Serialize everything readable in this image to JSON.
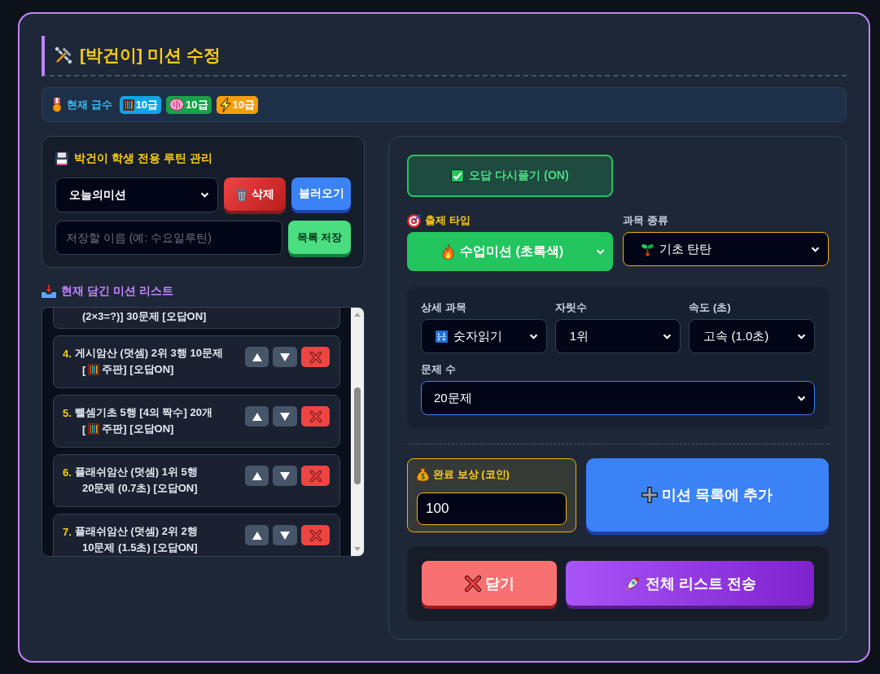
{
  "modal": {
    "title": "[박건이] 미션 수정"
  },
  "grade": {
    "label": "현재 급수",
    "badges": [
      {
        "kind": "abacus",
        "text": "10급",
        "color": "#0ea5e9"
      },
      {
        "kind": "brain",
        "text": "10급",
        "color": "#16a34a"
      },
      {
        "kind": "lightning",
        "text": "10급",
        "color": "#f59e0b"
      }
    ]
  },
  "routine_panel": {
    "title": "박건이 학생 전용 루틴 관리",
    "routine_select": {
      "value": "오늘의미션"
    },
    "delete_button": "삭제",
    "load_button": "불러오기",
    "name_field": {
      "placeholder": "저장할 이름 (예: 수요일루틴)"
    },
    "save_button": "목록 저장"
  },
  "mission_list": {
    "title": "현재 담긴 미션 리스트",
    "partial_item_text": "(2×3=?)] 30문제 [오답ON]",
    "items": [
      {
        "number": "4.",
        "line1": "게시암산 (덧셈) 2위 3행 10문제",
        "tool_open": "[",
        "line2": "주판] [오답ON]"
      },
      {
        "number": "5.",
        "line1": "뺄셈기초 5행 [4의 짝수] 20개",
        "tool_open": "[",
        "line2": "주판] [오답ON]"
      },
      {
        "number": "6.",
        "line1": "플래쉬암산 (덧셈) 1위 5행",
        "line2": "20문제 (0.7초) [오답ON]"
      },
      {
        "number": "7.",
        "line1": "플래쉬암산 (덧셈) 2위 2행",
        "line2": "10문제 (1.5초) [오답ON]"
      }
    ]
  },
  "form": {
    "review_toggle": {
      "label": "오답 다시풀기 (ON)",
      "on": true
    },
    "type_select": {
      "label": "출제 타입",
      "value": "수업미션 (초록색)"
    },
    "category_select": {
      "label": "과목 종류",
      "value": "기초 탄탄"
    },
    "detail_select": {
      "label": "상세 과목",
      "value": "숫자읽기"
    },
    "digits_select": {
      "label": "자릿수",
      "value": "1위"
    },
    "speed_select": {
      "label": "속도 (초)",
      "value": "고속 (1.0초)"
    },
    "count_select": {
      "label": "문제 수",
      "value": "20문제",
      "focused": true
    },
    "reward": {
      "label": "완료 보상 (코인)",
      "value": "100"
    },
    "add_button": "미션 목록에 추가"
  },
  "footer": {
    "close_button": "닫기",
    "send_button": "전체 리스트 전송"
  }
}
